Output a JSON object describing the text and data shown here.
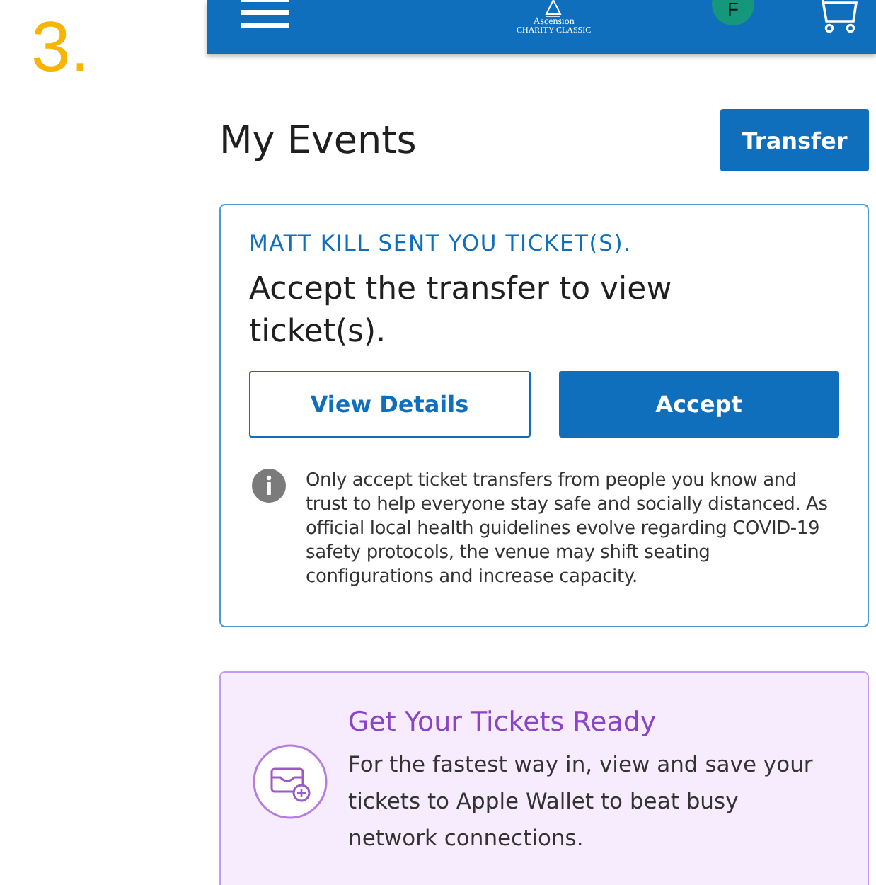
{
  "step": "3.",
  "header": {
    "logo_name": "Ascension",
    "logo_sub": "CHARITY CLASSIC",
    "avatar": "F"
  },
  "page_title": "My Events",
  "transfer_button": "Transfer",
  "transfer_card": {
    "sender": "MATT KILL SENT YOU TICKET(S).",
    "heading": "Accept the transfer to view ticket(s).",
    "buttons": [
      {
        "label": "View Details",
        "kind": "outline"
      },
      {
        "label": "Accept",
        "kind": "primary"
      }
    ],
    "notice": "Only accept ticket transfers from people you know and trust to help everyone stay safe and socially distanced. As official local health guidelines evolve regarding COVID-19 safety protocols, the venue may shift seating configurations and increase capacity."
  },
  "wallet_card": {
    "title": "Get Your Tickets Ready",
    "text": "For the fastest way in, view and save your tickets to Apple Wallet to beat busy network connections."
  }
}
